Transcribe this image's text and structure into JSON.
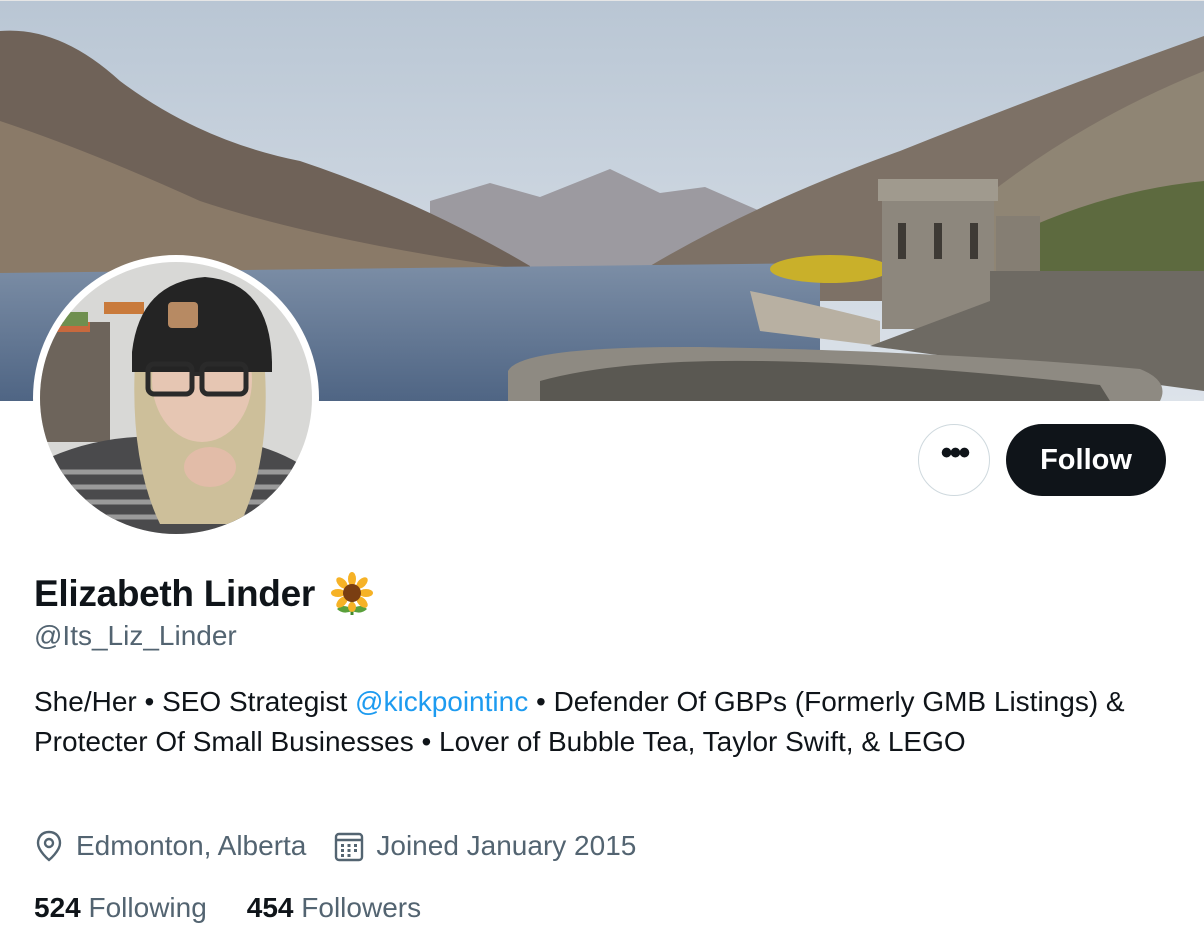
{
  "profile": {
    "display_name": "Elizabeth Linder",
    "name_emoji": "sunflower-emoji",
    "handle": "@Its_Liz_Linder",
    "bio": {
      "part1": "She/Her • SEO Strategist ",
      "mention": "@kickpointinc",
      "part2": " • Defender Of GBPs (Formerly GMB Listings) & Protecter Of Small Businesses • Lover of Bubble Tea, Taylor Swift, & LEGO"
    },
    "location": "Edmonton, Alberta",
    "joined": "Joined January 2015",
    "following_count": "524",
    "following_label": "Following",
    "followers_count": "454",
    "followers_label": "Followers"
  },
  "actions": {
    "more_label": "•••",
    "follow_label": "Follow"
  },
  "icons": {
    "more": "more-horizontal-icon",
    "location": "location-pin-icon",
    "calendar": "calendar-icon"
  },
  "colors": {
    "mention": "#1d9bf0",
    "follow_bg": "#0f1419",
    "secondary_text": "#536471"
  }
}
